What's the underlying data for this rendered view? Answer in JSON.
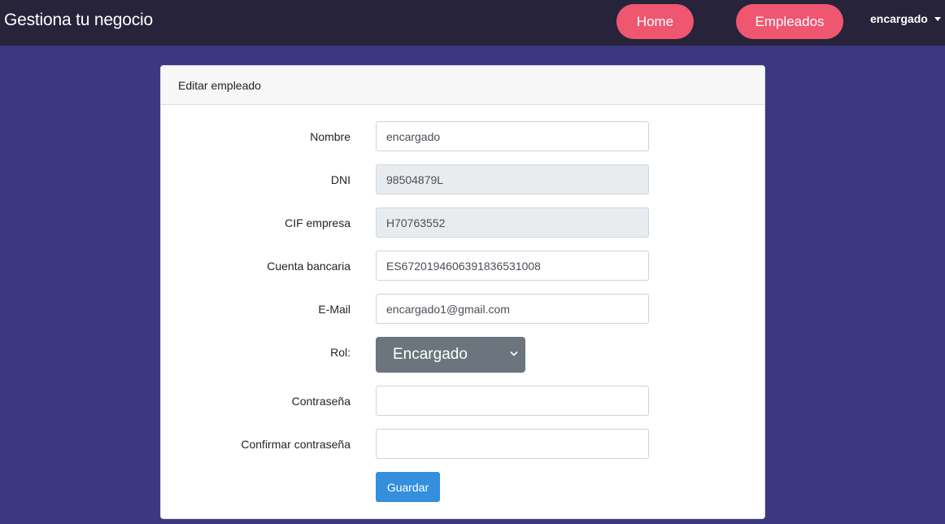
{
  "header": {
    "brand": "Gestiona tu negocio",
    "nav": {
      "home": "Home",
      "employees": "Empleados"
    },
    "user": "encargado"
  },
  "card": {
    "title": "Editar empleado"
  },
  "form": {
    "name": {
      "label": "Nombre",
      "value": "encargado"
    },
    "dni": {
      "label": "DNI",
      "value": "98504879L"
    },
    "cif": {
      "label": "CIF empresa",
      "value": "H70763552"
    },
    "bank": {
      "label": "Cuenta bancaria",
      "value": "ES6720194606391836531008"
    },
    "email": {
      "label": "E-Mail",
      "value": "encargado1@gmail.com"
    },
    "role": {
      "label": "Rol:",
      "value": "Encargado"
    },
    "password": {
      "label": "Contraseña",
      "value": ""
    },
    "confirm": {
      "label": "Confirmar contraseña",
      "value": ""
    },
    "submit": "Guardar"
  },
  "colors": {
    "page_bg": "#3b3880",
    "navbar_bg": "#27233a",
    "nav_pill": "#ef5670",
    "primary_button": "#3490dc",
    "select_bg": "#6c757d"
  },
  "icons": {
    "user_menu": "caret-down-icon",
    "select": "chevron-down-icon"
  }
}
